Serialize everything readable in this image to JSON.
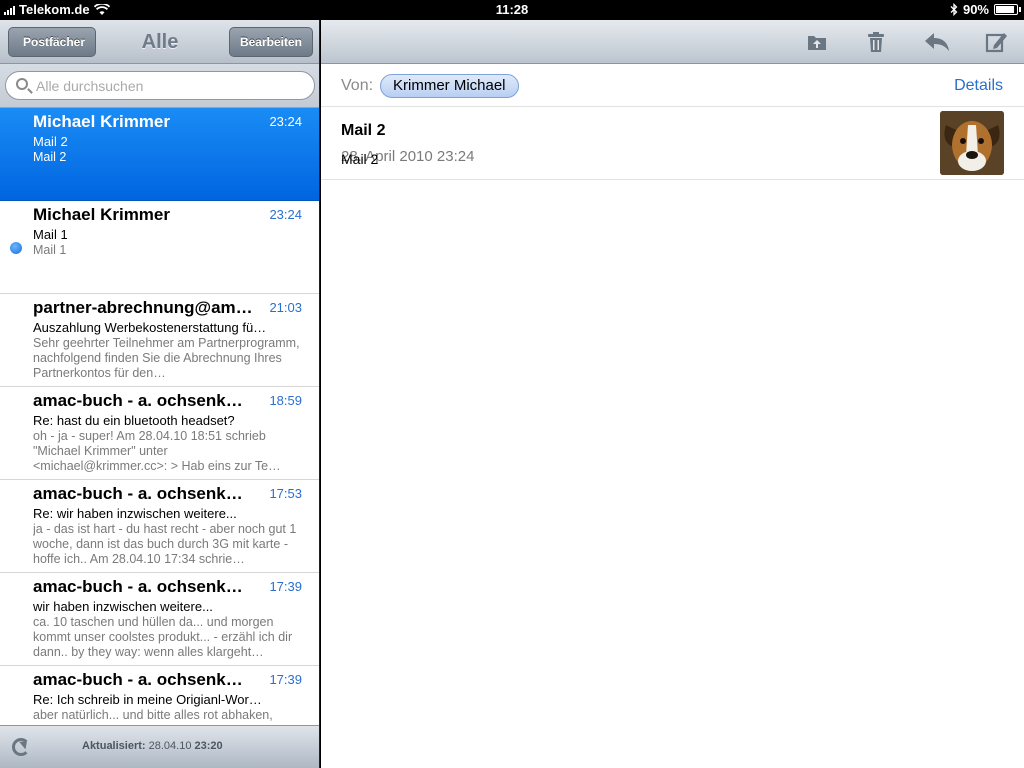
{
  "statusbar": {
    "carrier": "Telekom.de",
    "time": "11:28",
    "battery": "90%"
  },
  "left": {
    "back_label": "Postfächer",
    "title": "Alle",
    "edit_label": "Bearbeiten",
    "search_placeholder": "Alle durchsuchen",
    "messages": [
      {
        "sender": "Michael Krimmer",
        "time": "23:24",
        "subject": "Mail 2",
        "preview": "Mail 2"
      },
      {
        "sender": "Michael Krimmer",
        "time": "23:24",
        "subject": "Mail 1",
        "preview": "Mail 1"
      },
      {
        "sender": "partner-abrechnung@am…",
        "time": "21:03",
        "subject": "Auszahlung Werbekostenerstattung fü…",
        "preview": "Sehr geehrter Teilnehmer am Partnerprogramm, nachfolgend finden Sie die Abrechnung Ihres Partnerkontos für den…"
      },
      {
        "sender": "amac-buch - a. ochsenk…",
        "time": "18:59",
        "subject": "Re: hast du ein bluetooth headset?",
        "preview": "oh - ja - super! Am 28.04.10 18:51 schrieb \"Michael Krimmer\" unter <michael@krimmer.cc>: > Hab eins zur Te…"
      },
      {
        "sender": "amac-buch - a. ochsenk…",
        "time": "17:53",
        "subject": "Re: wir haben inzwischen weitere...",
        "preview": "ja - das ist hart - du hast recht - aber noch gut 1 woche, dann ist das buch durch 3G mit karte - hoffe ich.. Am 28.04.10 17:34 schrie…"
      },
      {
        "sender": "amac-buch - a. ochsenk…",
        "time": "17:39",
        "subject": "wir haben inzwischen weitere...",
        "preview": "ca. 10 taschen und hüllen da... und morgen kommt unser coolstes produkt... - erzähl ich dir dann.. by they way: wenn alles klargeht…"
      },
      {
        "sender": "amac-buch - a. ochsenk…",
        "time": "17:39",
        "subject": "Re: Ich schreib in meine Origianl-Wor…",
        "preview": "aber natürlich... und bitte alles rot abhaken,"
      }
    ],
    "toolbar": {
      "updated_label": "Aktualisiert:",
      "updated_date": "28.04.10",
      "updated_time": "23:20"
    }
  },
  "right": {
    "toolbar_icons": [
      "move-folder-icon",
      "trash-icon",
      "reply-icon",
      "compose-icon"
    ],
    "from_label": "Von:",
    "from_name": "Krimmer Michael",
    "details_label": "Details",
    "subject": "Mail 2",
    "date": "28. April 2010 23:24",
    "body": "Mail 2"
  },
  "colors": {
    "selection_blue": "#0a7bf0",
    "link_blue": "#2a6fd0"
  }
}
